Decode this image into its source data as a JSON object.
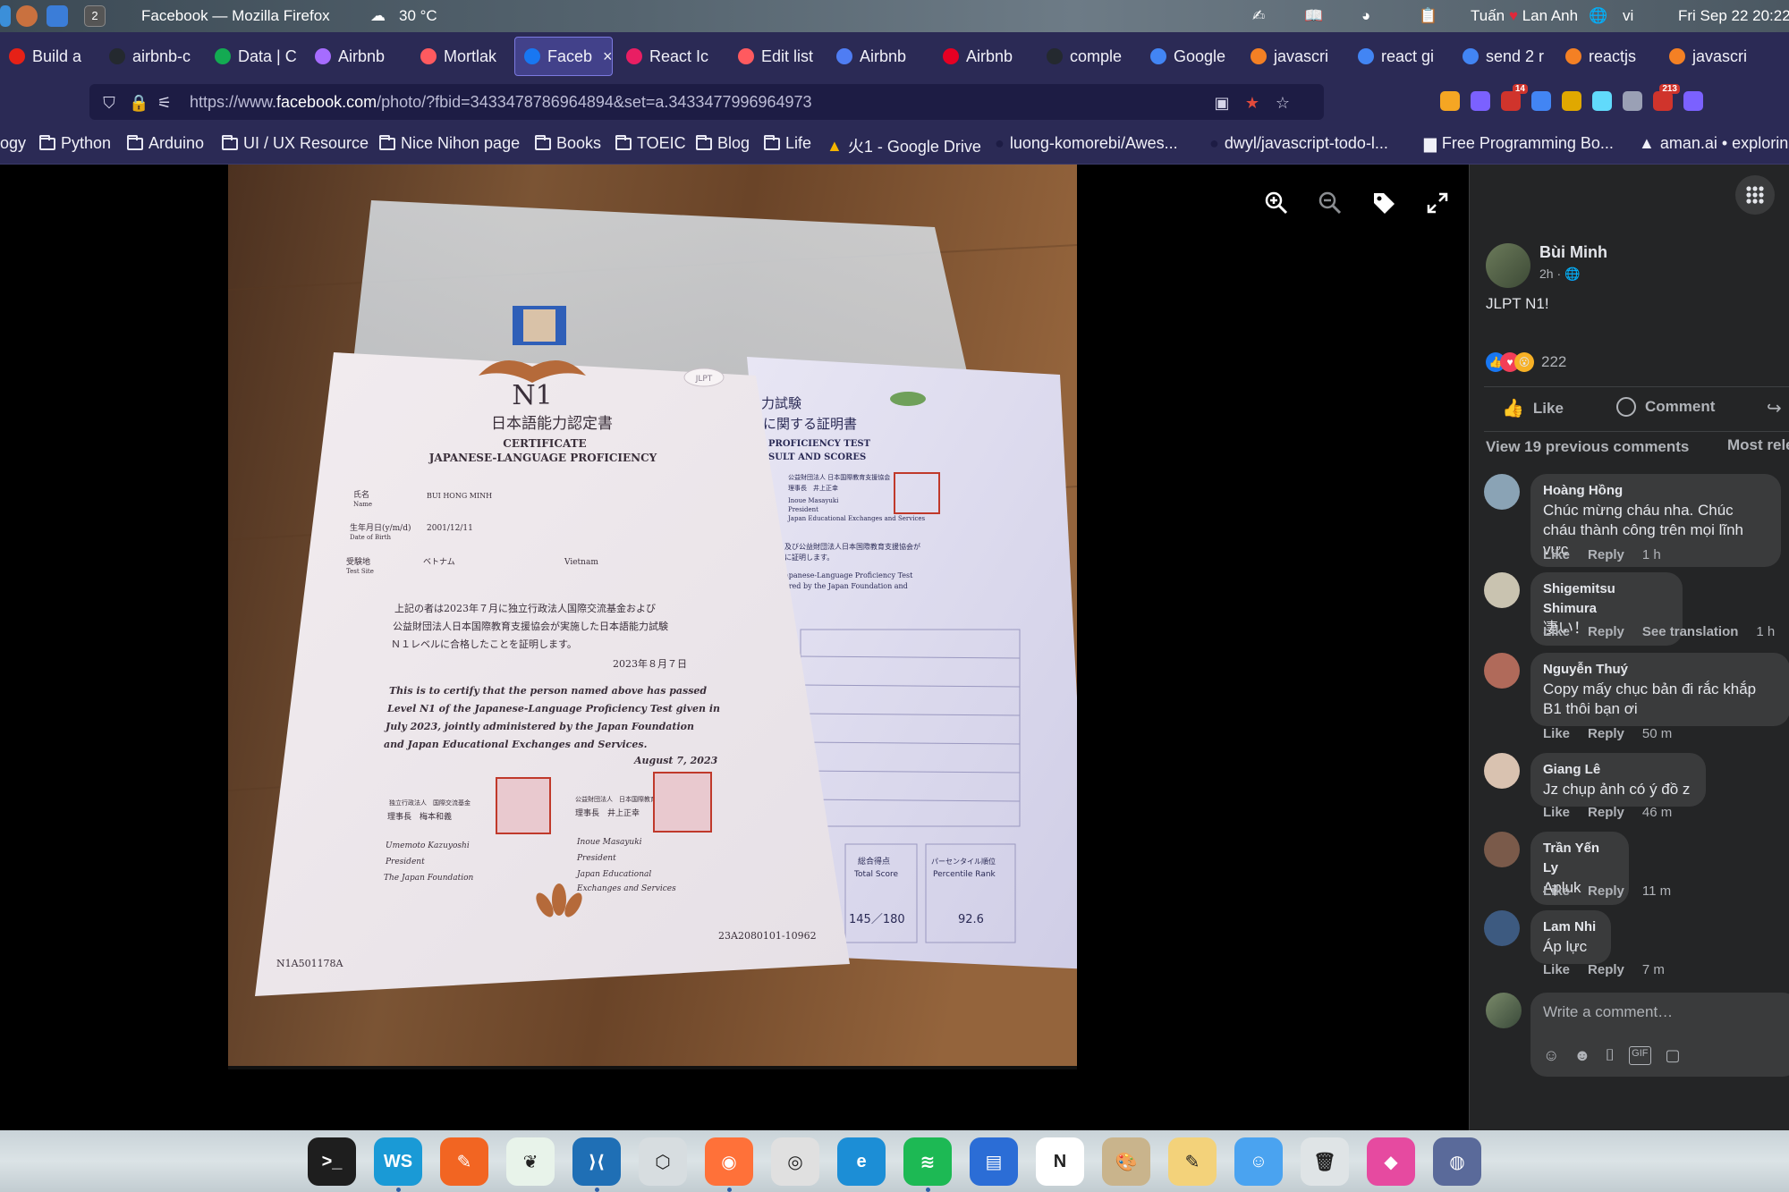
{
  "os_bar": {
    "window_title": "Facebook — Mozilla Firefox",
    "workspace_number": "2",
    "weather": "30 °C",
    "user_left": "Tuấn",
    "user_right": "Lan Anh",
    "language": "vi",
    "datetime": "Fri Sep 22  20:22"
  },
  "tabs": [
    {
      "label": "Build a",
      "icon": "youtube-icon",
      "color": "#e62117"
    },
    {
      "label": "airbnb-c",
      "icon": "github-icon",
      "color": "#24292f"
    },
    {
      "label": "Data | C",
      "icon": "leaf-icon",
      "color": "#13aa52"
    },
    {
      "label": "Airbnb",
      "icon": "vite-icon",
      "color": "#a66cff"
    },
    {
      "label": "Mortlak",
      "icon": "airbnb-icon",
      "color": "#ff5a5f"
    },
    {
      "label": "Faceb",
      "icon": "facebook-icon",
      "color": "#1877f2",
      "active": true
    },
    {
      "label": "React Ic",
      "icon": "react-icons-icon",
      "color": "#e91e63"
    },
    {
      "label": "Edit list",
      "icon": "airbnb-icon",
      "color": "#ff5a5f"
    },
    {
      "label": "Airbnb",
      "icon": "doc-icon",
      "color": "#4f7df3"
    },
    {
      "label": "Airbnb",
      "icon": "pinterest-icon",
      "color": "#e60023"
    },
    {
      "label": "comple",
      "icon": "github-icon",
      "color": "#24292f"
    },
    {
      "label": "Google",
      "icon": "translate-icon",
      "color": "#4285f4"
    },
    {
      "label": "javascri",
      "icon": "stackoverflow-icon",
      "color": "#f48024"
    },
    {
      "label": "react gi",
      "icon": "google-icon",
      "color": "#4285f4"
    },
    {
      "label": "send 2 r",
      "icon": "google-icon",
      "color": "#4285f4"
    },
    {
      "label": "reactjs",
      "icon": "stackoverflow-icon",
      "color": "#f48024"
    },
    {
      "label": "javascri",
      "icon": "stackoverflow-icon",
      "color": "#f48024"
    }
  ],
  "url": {
    "prefix": "https://www.",
    "domain": "facebook.com",
    "path": "/photo/?fbid=3433478786964894&set=a.3433477996964973"
  },
  "extensions": [
    {
      "name": "wrench-icon",
      "color": "#f5a623"
    },
    {
      "name": "h-extension-icon",
      "color": "#7b61ff"
    },
    {
      "name": "adblock-icon",
      "color": "#d0342c",
      "badge": "14"
    },
    {
      "name": "translate-ext-icon",
      "color": "#4285f4"
    },
    {
      "name": "x-extension-icon",
      "color": "#e0a800"
    },
    {
      "name": "react-devtools-icon",
      "color": "#61dafb"
    },
    {
      "name": "reader-icon",
      "color": "#9aa0b5"
    },
    {
      "name": "mail-icon",
      "color": "#d0342c",
      "badge": "213"
    },
    {
      "name": "puzzle-icon",
      "color": "#7b61ff"
    }
  ],
  "bookmarks": [
    {
      "label": "ogy",
      "type": "text"
    },
    {
      "label": "Python",
      "type": "folder"
    },
    {
      "label": "Arduino",
      "type": "folder"
    },
    {
      "label": "UI / UX Resource",
      "type": "folder"
    },
    {
      "label": "Nice Nihon page",
      "type": "folder"
    },
    {
      "label": "Books",
      "type": "folder"
    },
    {
      "label": "TOEIC",
      "type": "folder"
    },
    {
      "label": "Blog",
      "type": "folder"
    },
    {
      "label": "Life",
      "type": "folder"
    },
    {
      "label": "火1 - Google Drive",
      "type": "drive"
    },
    {
      "label": "luong-komorebi/Awes...",
      "type": "github"
    },
    {
      "label": "dwyl/javascript-todo-l...",
      "type": "github"
    },
    {
      "label": "Free Programming Bo...",
      "type": "book"
    },
    {
      "label": "aman.ai • explorin",
      "type": "site"
    }
  ],
  "certificate": {
    "level": "N1",
    "title_jp": "日本語能力認定書",
    "title_en_1": "CERTIFICATE",
    "title_en_2": "JAPANESE-LANGUAGE PROFICIENCY",
    "name_label": "氏名",
    "name_label_en": "Name",
    "name_value": "BUI HONG MINH",
    "dob_label": "生年月日(y/m/d)",
    "dob_label_en": "Date of Birth",
    "dob_value": "2001/12/11",
    "site_label": "受験地",
    "site_label_en": "Test Site",
    "site_jp": "ベトナム",
    "site_en": "Vietnam",
    "body_jp_1": "上記の者は2023年７月に独立行政法人国際交流基金および",
    "body_jp_2": "公益財団法人日本国際教育支援協会が実施した日本語能力試験",
    "body_jp_3": "Ｎ１レベルに合格したことを証明します。",
    "date_jp": "2023年８月７日",
    "body_en_1": "This is to certify that the person named above has passed",
    "body_en_2": "Level N1 of the Japanese-Language Proficiency Test given in",
    "body_en_3": "July 2023, jointly administered by the Japan Foundation",
    "body_en_4": "and Japan Educational Exchanges and Services.",
    "date_en": "August 7, 2023",
    "sig1_org": "独立行政法人　国際交流基金",
    "sig1_title": "理事長　梅本和義",
    "sig1_name": "Umemoto Kazuyoshi",
    "sig1_role": "President",
    "sig1_inst": "The Japan Foundation",
    "sig2_org": "公益財団法人　日本国際教育支援協会",
    "sig2_title": "理事長　井上正幸",
    "sig2_name": "Inoue Masayuki",
    "sig2_role": "President",
    "sig2_inst_1": "Japan Educational",
    "sig2_inst_2": "Exchanges and Services",
    "serial_left": "N1A501178A",
    "serial_right": "23A2080101-10962",
    "badge": "JLPT"
  },
  "score_sheet": {
    "title_jp_1": "力試験",
    "title_jp_2": "に関する証明書",
    "title_en_1": "PROFICIENCY TEST",
    "title_en_2": "SULT AND SCORES",
    "issuer_jp": "公益財団法人 日本国際教育支援協会",
    "issuer_title": "理事長　井上正幸",
    "issuer_name": "Inoue Masayuki",
    "issuer_role": "President",
    "issuer_org": "Japan Educational Exchanges and Services",
    "body_jp": "及び公益財団法人日本国際教育支援協会が",
    "body_jp_2": "に証明します。",
    "body_en_1": "apanese-Language Proficiency Test",
    "body_en_2": "ered by the Japan Foundation and",
    "total_label_jp": "総合得点",
    "total_label_en": "Total Score",
    "total_value": "145／180",
    "pct_label_jp": "パーセンタイル順位",
    "pct_label_en": "Percentile Rank",
    "pct_value": "92.6"
  },
  "photo_controls": [
    {
      "name": "zoom-in-icon"
    },
    {
      "name": "zoom-out-icon"
    },
    {
      "name": "tag-icon"
    },
    {
      "name": "fullscreen-icon"
    }
  ],
  "post": {
    "author": "Bùi Minh",
    "time": "2h ·",
    "text": "JLPT N1!",
    "reaction_count": "222",
    "like_label": "Like",
    "comment_label": "Comment",
    "view_previous": "View 19 previous comments",
    "sort_label": "Most rele"
  },
  "comments": [
    {
      "name": "Hoàng Hồng",
      "text": "Chúc mừng cháu nha. Chúc cháu thành công trên mọi lĩnh vực",
      "like": "Like",
      "reply": "Reply",
      "extra": "",
      "time": "1 h",
      "avatar_color": "#8aa3b5"
    },
    {
      "name": "Shigemitsu Shimura",
      "text": "凄い！",
      "like": "Like",
      "reply": "Reply",
      "extra": "See translation",
      "time": "1 h",
      "avatar_color": "#c9c3b0"
    },
    {
      "name": "Nguyễn Thuý",
      "text": "Copy mấy chục bản đi rắc khắp B1 thôi bạn ơi",
      "like": "Like",
      "reply": "Reply",
      "extra": "",
      "time": "50 m",
      "avatar_color": "#b06a5a"
    },
    {
      "name": "Giang Lê",
      "text": "Jz chụp ảnh có ý đồ z",
      "like": "Like",
      "reply": "Reply",
      "extra": "",
      "time": "46 m",
      "avatar_color": "#d9c2b0"
    },
    {
      "name": "Trần Yến Ly",
      "text": "Apluk",
      "like": "Like",
      "reply": "Reply",
      "extra": "",
      "time": "11 m",
      "avatar_color": "#7a5a4a"
    },
    {
      "name": "Lam Nhi",
      "text": "Áp lực",
      "like": "Like",
      "reply": "Reply",
      "extra": "",
      "time": "7 m",
      "avatar_color": "#3d5a80"
    }
  ],
  "composer": {
    "placeholder": "Write a comment…"
  },
  "dock": [
    {
      "name": "terminal-app",
      "color": "#1e1e1e",
      "glyph": ">_",
      "running": false
    },
    {
      "name": "webstorm-app",
      "color": "#1a9ad6",
      "glyph": "WS",
      "running": true
    },
    {
      "name": "pencil-app",
      "color": "#f26522",
      "glyph": "✎",
      "running": false
    },
    {
      "name": "mongodb-compass-app",
      "color": "#e8f3ea",
      "glyph": "❦",
      "running": false
    },
    {
      "name": "vscode-app",
      "color": "#1f6fb5",
      "glyph": "⟩⟨",
      "running": true
    },
    {
      "name": "cube-app",
      "color": "#d7dde0",
      "glyph": "⬡",
      "running": false
    },
    {
      "name": "firefox-app",
      "color": "#ff7139",
      "glyph": "◉",
      "running": true
    },
    {
      "name": "chrome-app",
      "color": "#e0e0e0",
      "glyph": "◎",
      "running": false
    },
    {
      "name": "edge-app",
      "color": "#1c8ed6",
      "glyph": "e",
      "running": false
    },
    {
      "name": "spotify-app",
      "color": "#1db954",
      "glyph": "≋",
      "running": true
    },
    {
      "name": "books-app",
      "color": "#2b6dd6",
      "glyph": "▤",
      "running": false
    },
    {
      "name": "notion-app",
      "color": "#ffffff",
      "glyph": "N",
      "running": false
    },
    {
      "name": "paint-app",
      "color": "#c9b48c",
      "glyph": "🎨",
      "running": false
    },
    {
      "name": "notes-app",
      "color": "#f3d27a",
      "glyph": "✎",
      "running": false
    },
    {
      "name": "finder-app",
      "color": "#4aa3f0",
      "glyph": "☺",
      "running": false
    },
    {
      "name": "trash-app",
      "color": "#dfe4e6",
      "glyph": "🗑",
      "running": false
    },
    {
      "name": "flow-app",
      "color": "#e64aa0",
      "glyph": "◆",
      "running": false
    },
    {
      "name": "globe-app",
      "color": "#5a6a9a",
      "glyph": "◍",
      "running": false
    }
  ]
}
